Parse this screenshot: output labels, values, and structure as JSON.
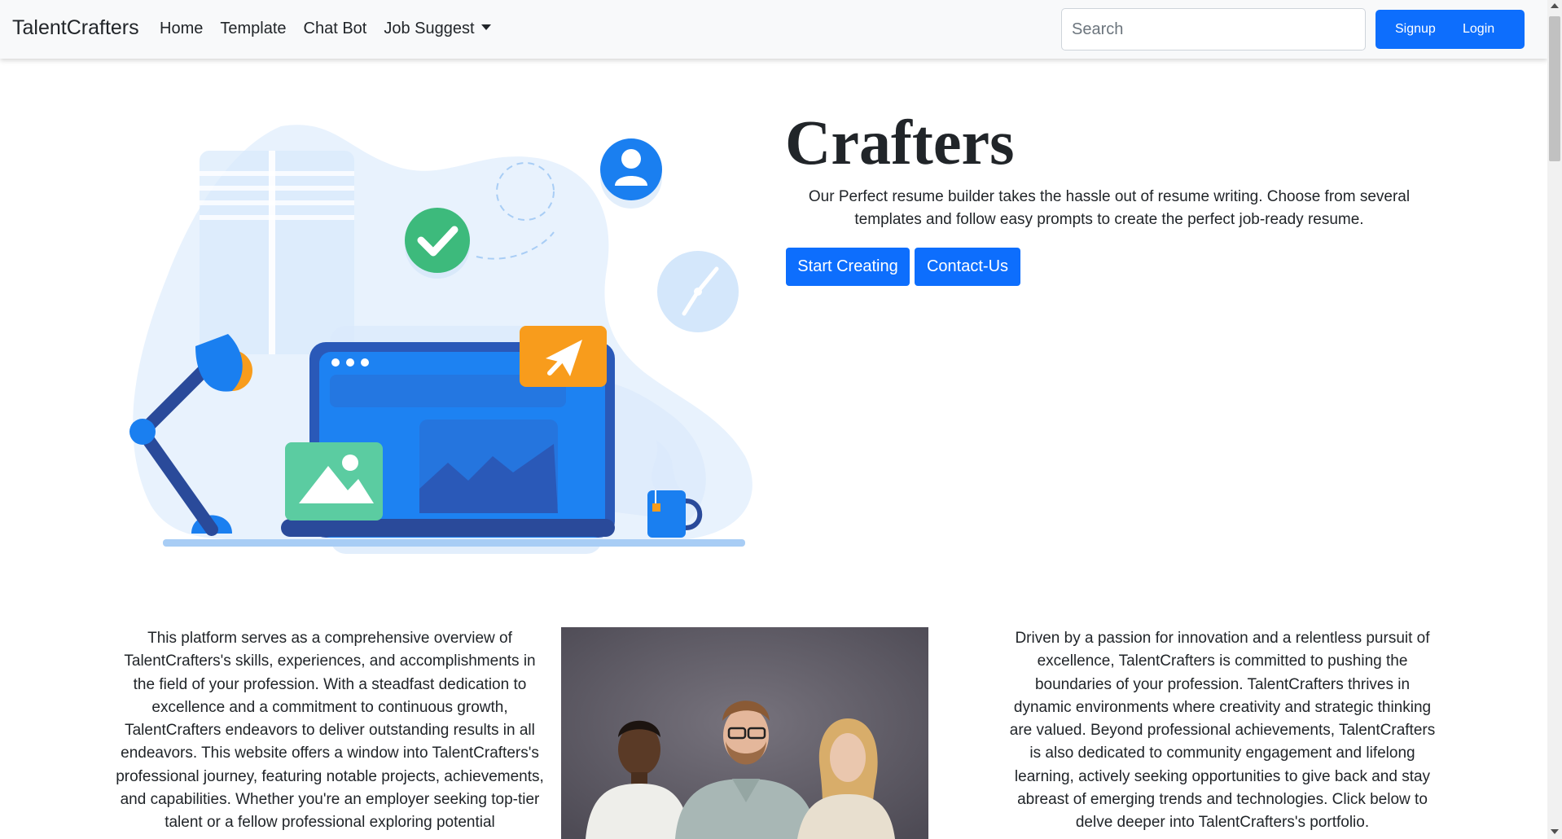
{
  "navbar": {
    "brand": "TalentCrafters",
    "links": [
      {
        "label": "Home"
      },
      {
        "label": "Template"
      },
      {
        "label": "Chat Bot"
      },
      {
        "label": "Job Suggest"
      }
    ],
    "search_placeholder": "Search",
    "signup_label": "Signup",
    "login_label": "Login"
  },
  "hero": {
    "title": "Crafters",
    "description": "Our Perfect resume builder takes the hassle out of resume writing. Choose from several templates and follow easy prompts to create the perfect job-ready resume.",
    "start_button": "Start Creating",
    "contact_button": "Contact-Us"
  },
  "about": {
    "left_text": "This platform serves as a comprehensive overview of TalentCrafters's skills, experiences, and accomplishments in the field of your profession. With a steadfast dedication to excellence and a commitment to continuous growth, TalentCrafters endeavors to deliver outstanding results in all endeavors. This website offers a window into TalentCrafters's professional journey, featuring notable projects, achievements, and capabilities. Whether you're an employer seeking top-tier talent or a fellow professional exploring potential",
    "right_text": "Driven by a passion for innovation and a relentless pursuit of excellence, TalentCrafters is committed to pushing the boundaries of your profession. TalentCrafters thrives in dynamic environments where creativity and strategic thinking are valued. Beyond professional achievements, TalentCrafters is also dedicated to community engagement and lifelong learning, actively seeking opportunities to give back and stay abreast of emerging trends and technologies. Click below to delve deeper into TalentCrafters's portfolio."
  },
  "colors": {
    "primary": "#0d6efd",
    "navbar_bg": "#f8f9fa",
    "text": "#212529"
  },
  "icons": [
    "chevron-down-icon",
    "user-icon",
    "check-icon",
    "send-icon",
    "image-icon",
    "clock-icon"
  ]
}
